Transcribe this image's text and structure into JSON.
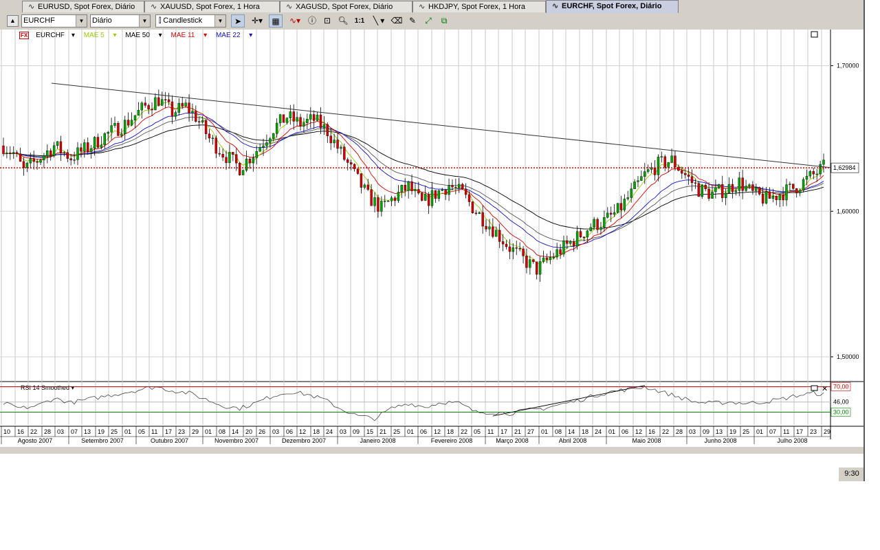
{
  "tabs": [
    {
      "label": "EURUSD, Spot Forex, Diário",
      "active": false
    },
    {
      "label": "XAUUSD, Spot Forex, 1 Hora",
      "active": false
    },
    {
      "label": "XAGUSD, Spot Forex, Diário",
      "active": false
    },
    {
      "label": "HKDJPY, Spot Forex, 1 Hora",
      "active": false
    },
    {
      "label": "EURCHF, Spot Forex, Diário",
      "active": true
    }
  ],
  "toolbar": {
    "symbol": "EURCHF",
    "period": "Diário",
    "chart_type": "Candlestick",
    "one_to_one": "1:1",
    "icons": [
      "cursor-arrow",
      "crosshair",
      "grid",
      "wave-indicator",
      "info",
      "zoom-box",
      "zoom",
      "one-to-one",
      "trend-line",
      "eraser",
      "pattern",
      "fibonacci",
      "channel"
    ]
  },
  "legend": {
    "fx": "FX",
    "symbol": "EURCHF",
    "items": [
      {
        "label": "MAE 5",
        "color": "#99cc00"
      },
      {
        "label": "MAE 50",
        "color": "#000000"
      },
      {
        "label": "MAE 11",
        "color": "#e00000"
      },
      {
        "label": "MAE 22",
        "color": "#1010cc"
      }
    ]
  },
  "rsi_label": "RSI 14 Smoothed",
  "current_price": "1,62984",
  "clock": "9:30",
  "colors": {
    "up": "#00aa00",
    "down": "#dd0000",
    "ma5": "#99cc00",
    "ma11": "#e00000",
    "ma22": "#1010cc",
    "ma50": "#000000",
    "price_line": "#cc0000"
  },
  "chart_data": {
    "type": "candlestick",
    "symbol": "EURCHF",
    "timeframe": "Diário",
    "y_ticks": [
      "1,70000",
      "1,60000",
      "1,50000"
    ],
    "y_tick_values": [
      1.7,
      1.6,
      1.5
    ],
    "ylim": [
      1.483,
      1.722
    ],
    "current_price": 1.62984,
    "months": [
      "Agosto 2007",
      "Setembro 2007",
      "Outubro 2007",
      "Novembro 2007",
      "Dezembro 2007",
      "Janeiro 2008",
      "Fevereiro 2008",
      "Março 2008",
      "Abril 2008",
      "Maio 2008",
      "Junho 2008",
      "Julho 2008"
    ],
    "day_ticks": [
      "10",
      "16",
      "22",
      "28",
      "03",
      "07",
      "13",
      "19",
      "25",
      "01",
      "05",
      "11",
      "17",
      "23",
      "29",
      "01",
      "08",
      "14",
      "20",
      "26",
      "03",
      "06",
      "12",
      "18",
      "24",
      "03",
      "09",
      "15",
      "21",
      "25",
      "01",
      "06",
      "12",
      "18",
      "22",
      "05",
      "11",
      "17",
      "21",
      "27",
      "01",
      "08",
      "14",
      "18",
      "24",
      "01",
      "06",
      "12",
      "16",
      "22",
      "28",
      "03",
      "09",
      "13",
      "19",
      "25",
      "01",
      "07",
      "11",
      "17",
      "23",
      "29"
    ],
    "price_path": [
      [
        0,
        1.645
      ],
      [
        3,
        1.64
      ],
      [
        6,
        1.628
      ],
      [
        10,
        1.635
      ],
      [
        15,
        1.645
      ],
      [
        20,
        1.637
      ],
      [
        26,
        1.645
      ],
      [
        30,
        1.652
      ],
      [
        36,
        1.66
      ],
      [
        42,
        1.672
      ],
      [
        46,
        1.677
      ],
      [
        50,
        1.668
      ],
      [
        54,
        1.672
      ],
      [
        57,
        1.665
      ],
      [
        61,
        1.65
      ],
      [
        65,
        1.64
      ],
      [
        70,
        1.63
      ],
      [
        75,
        1.642
      ],
      [
        80,
        1.657
      ],
      [
        84,
        1.665
      ],
      [
        88,
        1.66
      ],
      [
        92,
        1.663
      ],
      [
        96,
        1.655
      ],
      [
        100,
        1.64
      ],
      [
        104,
        1.625
      ],
      [
        108,
        1.61
      ],
      [
        112,
        1.602
      ],
      [
        116,
        1.61
      ],
      [
        120,
        1.617
      ],
      [
        124,
        1.605
      ],
      [
        128,
        1.612
      ],
      [
        132,
        1.618
      ],
      [
        136,
        1.612
      ],
      [
        140,
        1.6
      ],
      [
        145,
        1.588
      ],
      [
        150,
        1.575
      ],
      [
        155,
        1.565
      ],
      [
        158,
        1.56
      ],
      [
        162,
        1.568
      ],
      [
        166,
        1.575
      ],
      [
        170,
        1.582
      ],
      [
        174,
        1.59
      ],
      [
        178,
        1.593
      ],
      [
        182,
        1.6
      ],
      [
        186,
        1.612
      ],
      [
        190,
        1.625
      ],
      [
        194,
        1.632
      ],
      [
        198,
        1.635
      ],
      [
        202,
        1.625
      ],
      [
        206,
        1.615
      ],
      [
        210,
        1.612
      ],
      [
        214,
        1.615
      ],
      [
        218,
        1.62
      ],
      [
        222,
        1.612
      ],
      [
        226,
        1.608
      ],
      [
        230,
        1.612
      ],
      [
        235,
        1.617
      ],
      [
        240,
        1.625
      ],
      [
        243,
        1.63
      ]
    ],
    "trendline": {
      "from": [
        0,
        1.688
      ],
      "to": [
        243,
        1.63
      ],
      "color": "#333333"
    },
    "rsi": {
      "label": "RSI 14 Smoothed",
      "levels": [
        70,
        46,
        30
      ],
      "level_labels": [
        "70,00",
        "46,00",
        "30,00"
      ],
      "ylim": [
        10,
        76
      ],
      "path": [
        [
          0,
          44
        ],
        [
          5,
          36
        ],
        [
          10,
          40
        ],
        [
          15,
          52
        ],
        [
          20,
          45
        ],
        [
          25,
          50
        ],
        [
          30,
          55
        ],
        [
          35,
          60
        ],
        [
          40,
          65
        ],
        [
          45,
          70
        ],
        [
          50,
          64
        ],
        [
          55,
          60
        ],
        [
          60,
          50
        ],
        [
          65,
          40
        ],
        [
          70,
          36
        ],
        [
          75,
          45
        ],
        [
          80,
          56
        ],
        [
          85,
          62
        ],
        [
          90,
          58
        ],
        [
          95,
          50
        ],
        [
          100,
          35
        ],
        [
          105,
          24
        ],
        [
          110,
          20
        ],
        [
          115,
          36
        ],
        [
          120,
          44
        ],
        [
          125,
          38
        ],
        [
          130,
          46
        ],
        [
          135,
          44
        ],
        [
          140,
          30
        ],
        [
          145,
          30
        ],
        [
          150,
          28
        ],
        [
          155,
          33
        ],
        [
          160,
          36
        ],
        [
          165,
          42
        ],
        [
          170,
          48
        ],
        [
          175,
          56
        ],
        [
          180,
          62
        ],
        [
          185,
          66
        ],
        [
          190,
          70
        ],
        [
          195,
          62
        ],
        [
          200,
          54
        ],
        [
          205,
          46
        ],
        [
          210,
          44
        ],
        [
          215,
          46
        ],
        [
          220,
          44
        ],
        [
          225,
          46
        ],
        [
          230,
          50
        ],
        [
          235,
          56
        ],
        [
          240,
          60
        ],
        [
          243,
          58
        ]
      ],
      "trendline": {
        "from": [
          145,
          24
        ],
        "to": [
          190,
          72
        ]
      }
    }
  }
}
